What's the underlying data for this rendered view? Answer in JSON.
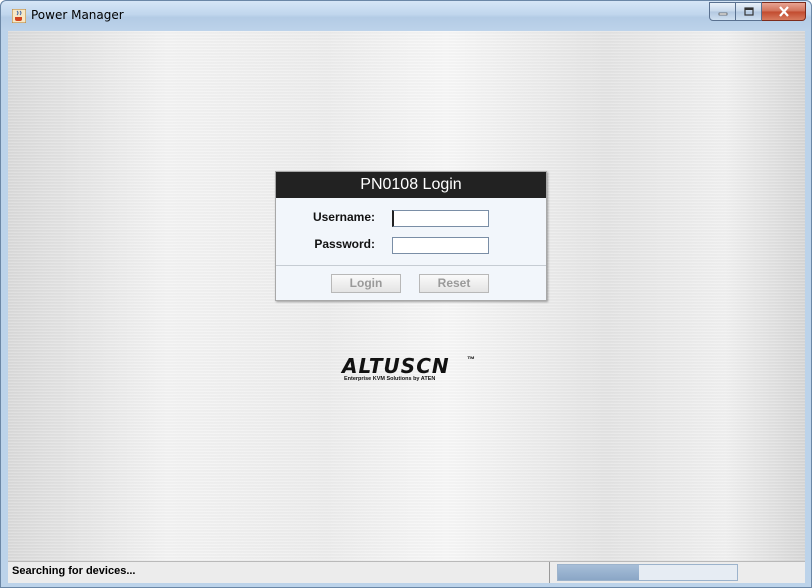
{
  "window": {
    "title": "Power Manager",
    "icons": {
      "app": "java-cup-icon",
      "minimize": "minimize-icon",
      "maximize": "maximize-icon",
      "close": "close-icon"
    }
  },
  "login": {
    "title": "PN0108 Login",
    "username_label": "Username:",
    "username_value": "",
    "password_label": "Password:",
    "password_value": "",
    "login_button": "Login",
    "reset_button": "Reset"
  },
  "logo": {
    "main": "ALTUSCN",
    "tm": "™",
    "subtitle": "Enterprise KVM Solutions by ATEN"
  },
  "status": {
    "text": "Searching for devices...",
    "progress_fraction": 0.45
  },
  "colors": {
    "header_bg": "#222222",
    "progress_fill": "#8aa6c6"
  }
}
